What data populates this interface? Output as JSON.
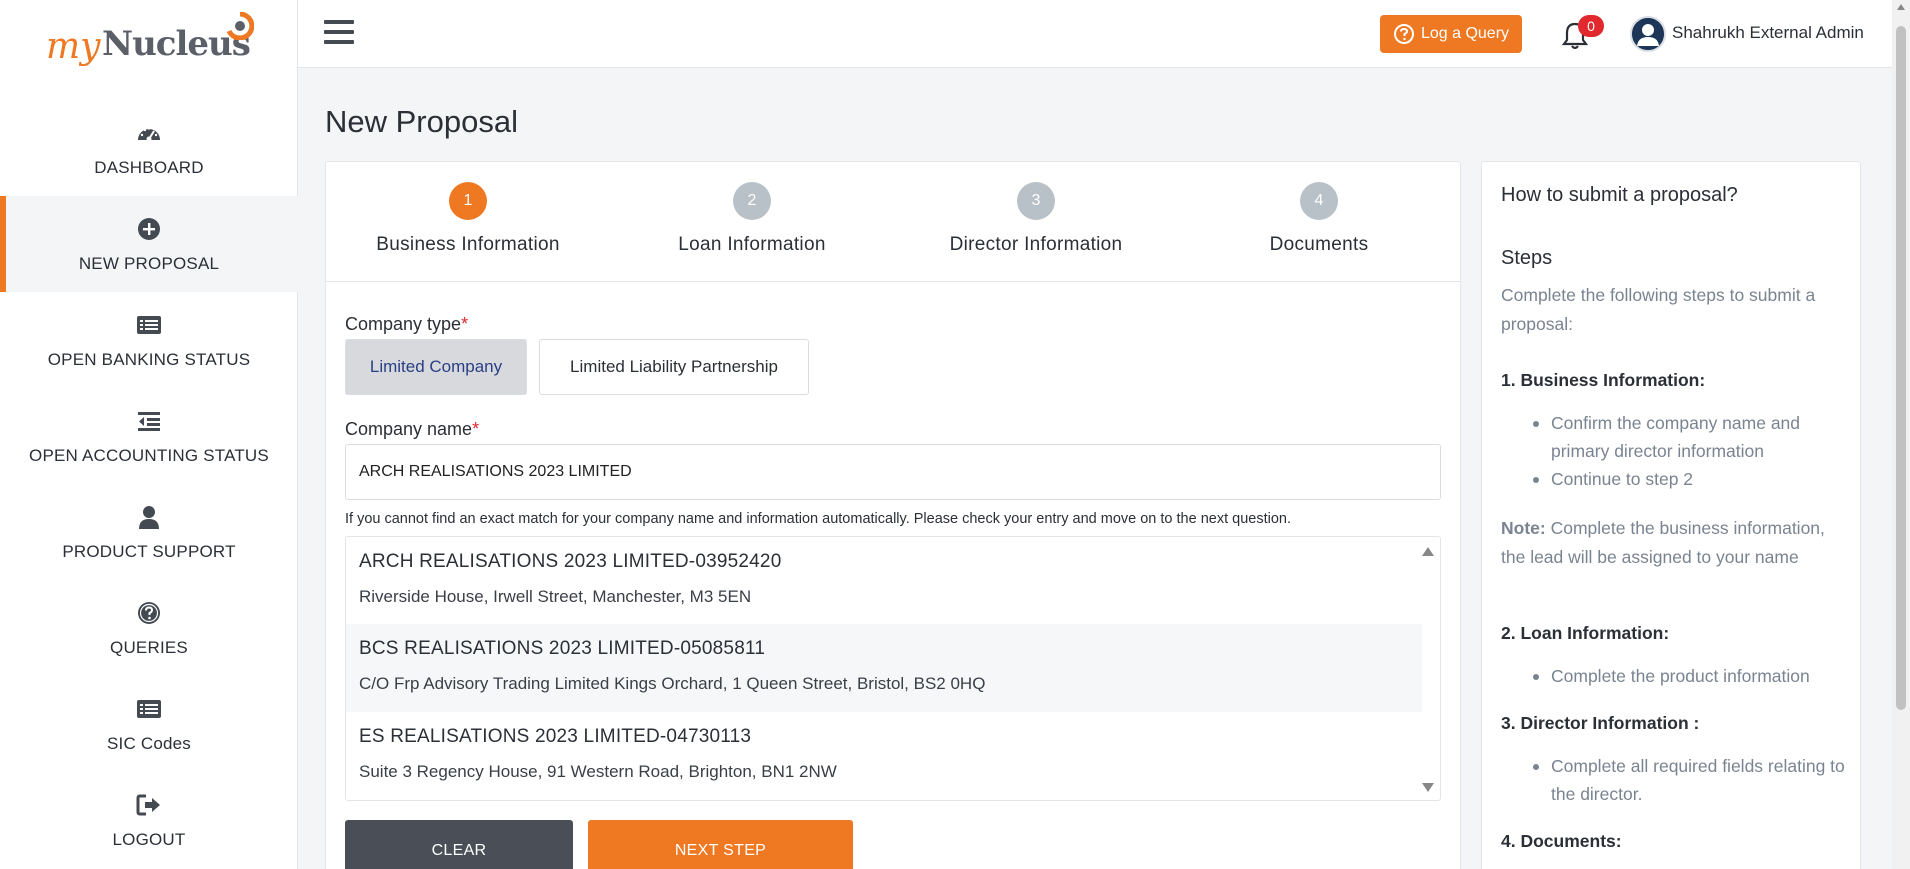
{
  "brand": {
    "logo_my": "my",
    "logo_nucleus": "Nucleus"
  },
  "sidebar": {
    "items": [
      {
        "label": "DASHBOARD",
        "icon": "dashboard-icon"
      },
      {
        "label": "NEW PROPOSAL",
        "icon": "plus-circle-icon",
        "active": true
      },
      {
        "label": "OPEN BANKING STATUS",
        "icon": "list-card-icon"
      },
      {
        "label": "OPEN ACCOUNTING STATUS",
        "icon": "indent-list-icon"
      },
      {
        "label": "PRODUCT SUPPORT",
        "icon": "user-icon"
      },
      {
        "label": "QUERIES",
        "icon": "question-circle-icon"
      },
      {
        "label": "SIC Codes",
        "icon": "list-card-icon"
      },
      {
        "label": "LOGOUT",
        "icon": "sign-out-icon"
      }
    ]
  },
  "topbar": {
    "query_label": "Log a Query",
    "notifications_count": "0",
    "user_name": "Shahrukh External Admin"
  },
  "page": {
    "title": "New Proposal"
  },
  "stepper": {
    "steps": [
      {
        "num": "1",
        "label": "Business Information",
        "active": true
      },
      {
        "num": "2",
        "label": "Loan Information"
      },
      {
        "num": "3",
        "label": "Director Information"
      },
      {
        "num": "4",
        "label": "Documents"
      }
    ]
  },
  "form": {
    "company_type_label": "Company type",
    "required_mark": "*",
    "company_types": [
      "Limited Company",
      "Limited Liability Partnership"
    ],
    "company_type_selected": "Limited Company",
    "company_name_label": "Company name",
    "company_name_value": "ARCH REALISATIONS 2023 LIMITED",
    "hint": "If you cannot find an exact match for your company name and information automatically. Please check your entry and move on to the next question.",
    "results": [
      {
        "name": "ARCH REALISATIONS 2023 LIMITED-03952420",
        "address": "Riverside House, Irwell Street, Manchester, M3 5EN"
      },
      {
        "name": "BCS REALISATIONS 2023 LIMITED-05085811",
        "address": "C/O Frp Advisory Trading Limited Kings Orchard, 1 Queen Street, Bristol, BS2 0HQ"
      },
      {
        "name": "ES REALISATIONS 2023 LIMITED-04730113",
        "address": "Suite 3 Regency House, 91 Western Road, Brighton, BN1 2NW"
      }
    ],
    "clear_label": "CLEAR",
    "next_label": "NEXT STEP"
  },
  "help": {
    "title": "How to submit a proposal?",
    "steps_heading": "Steps",
    "intro": "Complete the following steps to submit a proposal:",
    "sections": [
      {
        "heading": "1. Business Information:",
        "items": [
          "Confirm the company name and primary director information",
          "Continue to step 2"
        ]
      },
      {
        "heading": "2. Loan Information:",
        "items": [
          "Complete the product information"
        ]
      },
      {
        "heading": "3. Director Information :",
        "items": [
          "Complete all required fields relating to the director."
        ]
      },
      {
        "heading": "4. Documents:",
        "items": []
      }
    ],
    "note_label": "Note:",
    "note_text": " Complete the business information, the lead will be assigned to your name"
  },
  "colors": {
    "accent": "#ef7823",
    "dark_button": "#494e57",
    "badge": "#e0282e",
    "muted_text": "#7a8491"
  }
}
